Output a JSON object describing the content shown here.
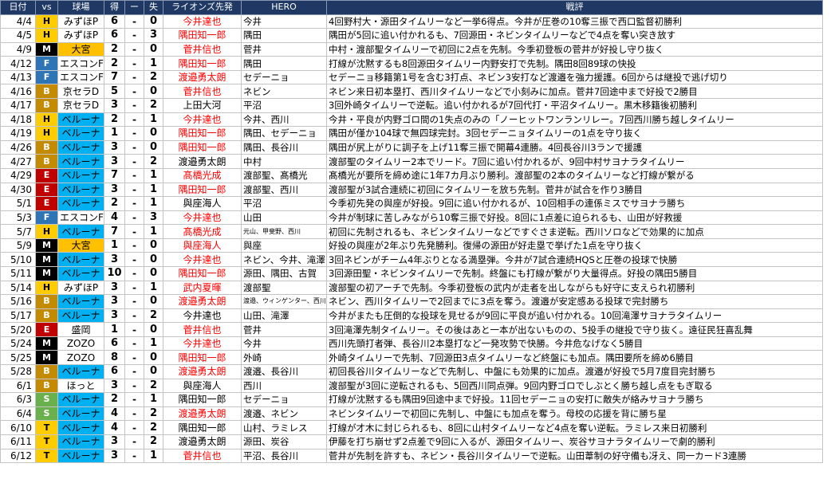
{
  "columns": [
    "日付",
    "vs",
    "球場",
    "得",
    "ー",
    "失",
    "ライオンズ先発",
    "HERO",
    "戦評"
  ],
  "team_colors": {
    "H": {
      "bg": "#ffcc00",
      "fg": "#000000"
    },
    "F": {
      "bg": "#2e75b6",
      "fg": "#ffffff"
    },
    "M": {
      "bg": "#000000",
      "fg": "#ffffff"
    },
    "B": {
      "bg": "#c58b00",
      "fg": "#ffffff"
    },
    "E": {
      "bg": "#c00000",
      "fg": "#ffffff"
    },
    "S": {
      "bg": "#6ab04c",
      "fg": "#ffffff"
    },
    "T": {
      "bg": "#ffcc00",
      "fg": "#000000"
    }
  },
  "park_colors": {
    "ベルーナ": "#00b0f0",
    "大宮": "#ffc000"
  },
  "rows": [
    {
      "date": "4/4",
      "vs": "H",
      "park": "みずほP",
      "runs": "6",
      "dash": "-",
      "allowed": "0",
      "pitcher": "今井達也",
      "pitcher_win": true,
      "hero": "今井",
      "review": "4回野村大・源田タイムリーなど一挙6得点。今井が圧巻の10奪三振で西口監督初勝利"
    },
    {
      "date": "4/5",
      "vs": "H",
      "park": "みずほP",
      "runs": "6",
      "dash": "-",
      "allowed": "3",
      "pitcher": "隅田知一郎",
      "pitcher_win": true,
      "hero": "隅田",
      "review": "隅田が5回に追い付かれるも、7回源田・ネビンタイムリーなどで4点を奪い突き放す"
    },
    {
      "date": "4/9",
      "vs": "M",
      "park": "大宮",
      "runs": "2",
      "dash": "-",
      "allowed": "0",
      "pitcher": "菅井信也",
      "pitcher_win": true,
      "hero": "菅井",
      "review": "中村・渡部聖タイムリーで初回に2点を先制。今季初登板の菅井が好投し守り抜く"
    },
    {
      "date": "4/12",
      "vs": "F",
      "park": "エスコンF",
      "runs": "2",
      "dash": "-",
      "allowed": "1",
      "pitcher": "隅田知一郎",
      "pitcher_win": true,
      "hero": "隅田",
      "review": "打線が沈黙するも8回源田タイムリー内野安打で先制。隅田8回89球の快投"
    },
    {
      "date": "4/13",
      "vs": "F",
      "park": "エスコンF",
      "runs": "7",
      "dash": "-",
      "allowed": "2",
      "pitcher": "渡邉勇太朗",
      "pitcher_win": true,
      "hero": "セデーニョ",
      "review": "セデーニョ移籍第1号を含む3打点、ネビン3安打など渡邉を強力援護。6回からは継投で逃げ切り"
    },
    {
      "date": "4/16",
      "vs": "B",
      "park": "京セラD",
      "runs": "5",
      "dash": "-",
      "allowed": "0",
      "pitcher": "菅井信也",
      "pitcher_win": true,
      "hero": "ネビン",
      "review": "ネビン来日初本塁打、西川タイムリーなどで小刻みに加点。菅井7回途中まで好投で2勝目"
    },
    {
      "date": "4/17",
      "vs": "B",
      "park": "京セラD",
      "runs": "3",
      "dash": "-",
      "allowed": "2",
      "pitcher": "上田大河",
      "pitcher_win": false,
      "hero": "平沼",
      "review": "3回外崎タイムリーで逆転。追い付かれるが7回代打・平沼タイムリー。黒木移籍後初勝利"
    },
    {
      "date": "4/18",
      "vs": "H",
      "park": "ベルーナ",
      "runs": "2",
      "dash": "-",
      "allowed": "1",
      "pitcher": "今井達也",
      "pitcher_win": true,
      "hero": "今井、西川",
      "review": "今井・平良が内野ゴロ間の1失点のみの「ノーヒットワンランリレー。7回西川勝ち越しタイムリー"
    },
    {
      "date": "4/19",
      "vs": "H",
      "park": "ベルーナ",
      "runs": "1",
      "dash": "-",
      "allowed": "0",
      "pitcher": "隅田知一郎",
      "pitcher_win": true,
      "hero": "隅田、セデーニョ",
      "review": "隅田が僅か104球で無四球完封。3回セデーニョタイムリーの1点を守り抜く"
    },
    {
      "date": "4/26",
      "vs": "B",
      "park": "ベルーナ",
      "runs": "3",
      "dash": "-",
      "allowed": "0",
      "pitcher": "隅田知一郎",
      "pitcher_win": true,
      "hero": "隅田、長谷川",
      "review": "隅田が尻上がりに調子を上げ11奪三振で開幕4連勝。4回長谷川3ランで援護"
    },
    {
      "date": "4/27",
      "vs": "B",
      "park": "ベルーナ",
      "runs": "3",
      "dash": "-",
      "allowed": "2",
      "pitcher": "渡邉勇太朗",
      "pitcher_win": false,
      "hero": "中村",
      "review": "渡部聖のタイムリー2本でリード。7回に追い付かれるが、9回中村サヨナラタイムリー"
    },
    {
      "date": "4/29",
      "vs": "E",
      "park": "ベルーナ",
      "runs": "7",
      "dash": "-",
      "allowed": "1",
      "pitcher": "髙橋光成",
      "pitcher_win": true,
      "hero": "渡部聖、髙橋光",
      "review": "髙橋光が要所を締め途に1年7カ月ぶり勝利。渡部聖の2本のタイムリーなど打線が繋がる"
    },
    {
      "date": "4/30",
      "vs": "E",
      "park": "ベルーナ",
      "runs": "3",
      "dash": "-",
      "allowed": "1",
      "pitcher": "隅田知一郎",
      "pitcher_win": true,
      "hero": "渡部聖、西川",
      "review": "渡部聖が3試合連続に初回にタイムリーを放ち先制。菅井が試合を作り3勝目"
    },
    {
      "date": "5/1",
      "vs": "E",
      "park": "ベルーナ",
      "runs": "2",
      "dash": "-",
      "allowed": "1",
      "pitcher": "與座海人",
      "pitcher_win": false,
      "hero": "平沼",
      "review": "今季初先発の與座が好投。9回に追い付かれるが、10回相手の連係ミスでサヨナラ勝ち"
    },
    {
      "date": "5/3",
      "vs": "F",
      "park": "エスコンF",
      "runs": "4",
      "dash": "-",
      "allowed": "3",
      "pitcher": "今井達也",
      "pitcher_win": true,
      "hero": "山田",
      "review": "今井が制球に苦しみながら10奪三振で好投。8回に1点差に迫られるも、山田が好救援"
    },
    {
      "date": "5/7",
      "vs": "H",
      "park": "ベルーナ",
      "runs": "7",
      "dash": "-",
      "allowed": "1",
      "pitcher": "髙橋光成",
      "pitcher_win": true,
      "hero": "元山、甲斐野、西川",
      "hero_small": true,
      "review": "初回に先制されるも、ネビンタイムリーなどですぐさま逆転。西川ソロなどで効果的に加点"
    },
    {
      "date": "5/9",
      "vs": "M",
      "park": "大宮",
      "runs": "1",
      "dash": "-",
      "allowed": "0",
      "pitcher": "與座海人",
      "pitcher_win": true,
      "hero": "與座",
      "review": "好投の與座が2年ぶり先発勝利。復帰の源田が好走塁で挙げた1点を守り抜く"
    },
    {
      "date": "5/10",
      "vs": "M",
      "park": "ベルーナ",
      "runs": "3",
      "dash": "-",
      "allowed": "0",
      "pitcher": "今井達也",
      "pitcher_win": true,
      "hero": "ネビン、今井、滝澤",
      "review": "3回ネビンがチーム4年ぶりとなる満塁弾。今井が7試合連続HQSと圧巻の投球で快勝"
    },
    {
      "date": "5/11",
      "vs": "M",
      "park": "ベルーナ",
      "runs": "10",
      "dash": "-",
      "allowed": "0",
      "pitcher": "隅田知一郎",
      "pitcher_win": true,
      "hero": "源田、隅田、古賀",
      "review": "3回源田聖・ネビンタイムリーで先制。終盤にも打線が繋がり大量得点。好投の隅田5勝目"
    },
    {
      "date": "5/14",
      "vs": "H",
      "park": "みずほP",
      "runs": "3",
      "dash": "-",
      "allowed": "1",
      "pitcher": "武内夏暉",
      "pitcher_win": true,
      "hero": "渡部聖",
      "review": "渡部聖の初アーチで先制。今季初登板の武内が走者を出しながらも好守に支えられ初勝利"
    },
    {
      "date": "5/16",
      "vs": "B",
      "park": "ベルーナ",
      "runs": "3",
      "dash": "-",
      "allowed": "0",
      "pitcher": "渡邉勇太朗",
      "pitcher_win": true,
      "hero": "渡邉、ウィンゲンター、西川",
      "hero_small": true,
      "review": "ネビン、西川タイムリーで2回までに3点を奪う。渡邉が安定感ある投球で完封勝ち"
    },
    {
      "date": "5/17",
      "vs": "B",
      "park": "ベルーナ",
      "runs": "3",
      "dash": "-",
      "allowed": "2",
      "pitcher": "今井達也",
      "pitcher_win": false,
      "hero": "山田、滝澤",
      "review": "今井がまたも圧倒的な投球を見せるが9回に平良が追い付かれる。10回滝澤サヨナラタイムリー"
    },
    {
      "date": "5/20",
      "vs": "E",
      "park": "盛岡",
      "runs": "1",
      "dash": "-",
      "allowed": "0",
      "pitcher": "菅井信也",
      "pitcher_win": true,
      "hero": "菅井",
      "review": "3回滝澤先制タイムリー。その後はあと一本が出ないものの、5投手の継投で守り抜く。遠征民狂喜乱舞"
    },
    {
      "date": "5/24",
      "vs": "M",
      "park": "ZOZO",
      "runs": "6",
      "dash": "-",
      "allowed": "1",
      "pitcher": "今井達也",
      "pitcher_win": true,
      "hero": "今井",
      "review": "西川先頭打者弾、長谷川2本塁打など一発攻勢で快勝。今井危なげなく5勝目"
    },
    {
      "date": "5/25",
      "vs": "M",
      "park": "ZOZO",
      "runs": "8",
      "dash": "-",
      "allowed": "0",
      "pitcher": "隅田知一郎",
      "pitcher_win": true,
      "hero": "外崎",
      "review": "外崎タイムリーで先制、7回源田3点タイムリーなど終盤にも加点。隅田要所を締め6勝目"
    },
    {
      "date": "5/28",
      "vs": "B",
      "park": "ベルーナ",
      "runs": "6",
      "dash": "-",
      "allowed": "0",
      "pitcher": "渡邉勇太朗",
      "pitcher_win": true,
      "hero": "渡邉、長谷川",
      "review": "初回長谷川タイムリーなどで先制し、中盤にも効果的に加点。渡邉が好投で5月7度目完封勝ち"
    },
    {
      "date": "6/1",
      "vs": "B",
      "park": "ほっと",
      "runs": "3",
      "dash": "-",
      "allowed": "2",
      "pitcher": "與座海人",
      "pitcher_win": false,
      "hero": "西川",
      "review": "渡部聖が3回に逆転されるも、5回西川同点弾。9回内野ゴロでしぶとく勝ち越し点をもぎ取る"
    },
    {
      "date": "6/3",
      "vs": "S",
      "park": "ベルーナ",
      "runs": "2",
      "dash": "-",
      "allowed": "1",
      "pitcher": "隅田知一郎",
      "pitcher_win": false,
      "hero": "セデーニョ",
      "review": "打線が沈黙するも隅田9回途中まで好投。11回セデーニョの安打に敵失が絡みサヨナラ勝ち"
    },
    {
      "date": "6/4",
      "vs": "S",
      "park": "ベルーナ",
      "runs": "4",
      "dash": "-",
      "allowed": "2",
      "pitcher": "渡邉勇太朗",
      "pitcher_win": true,
      "hero": "渡邉、ネビン",
      "review": "ネビンタイムリーで初回に先制し、中盤にも加点を奪う。母校の応援を背に勝ち星"
    },
    {
      "date": "6/10",
      "vs": "T",
      "park": "ベルーナ",
      "runs": "4",
      "dash": "-",
      "allowed": "2",
      "pitcher": "隅田知一郎",
      "pitcher_win": false,
      "hero": "山村、ラミレス",
      "review": "打線が才木に封じられるも、8回に山村タイムリーなど4点を奪い逆転。ラミレス来日初勝利"
    },
    {
      "date": "6/11",
      "vs": "T",
      "park": "ベルーナ",
      "runs": "3",
      "dash": "-",
      "allowed": "2",
      "pitcher": "渡邉勇太朗",
      "pitcher_win": false,
      "hero": "源田、炭谷",
      "review": "伊藤を打ち崩せず2点差で9回に入るが、源田タイムリー、炭谷サヨナラタイムリーで劇的勝利"
    },
    {
      "date": "6/12",
      "vs": "T",
      "park": "ベルーナ",
      "runs": "3",
      "dash": "-",
      "allowed": "1",
      "pitcher": "菅井信也",
      "pitcher_win": true,
      "hero": "平沼、長谷川",
      "review": "菅井が先制を許すも、ネビン・長谷川タイムリーで逆転。山田葦制の好守備も冴え、同一カード3連勝"
    }
  ]
}
